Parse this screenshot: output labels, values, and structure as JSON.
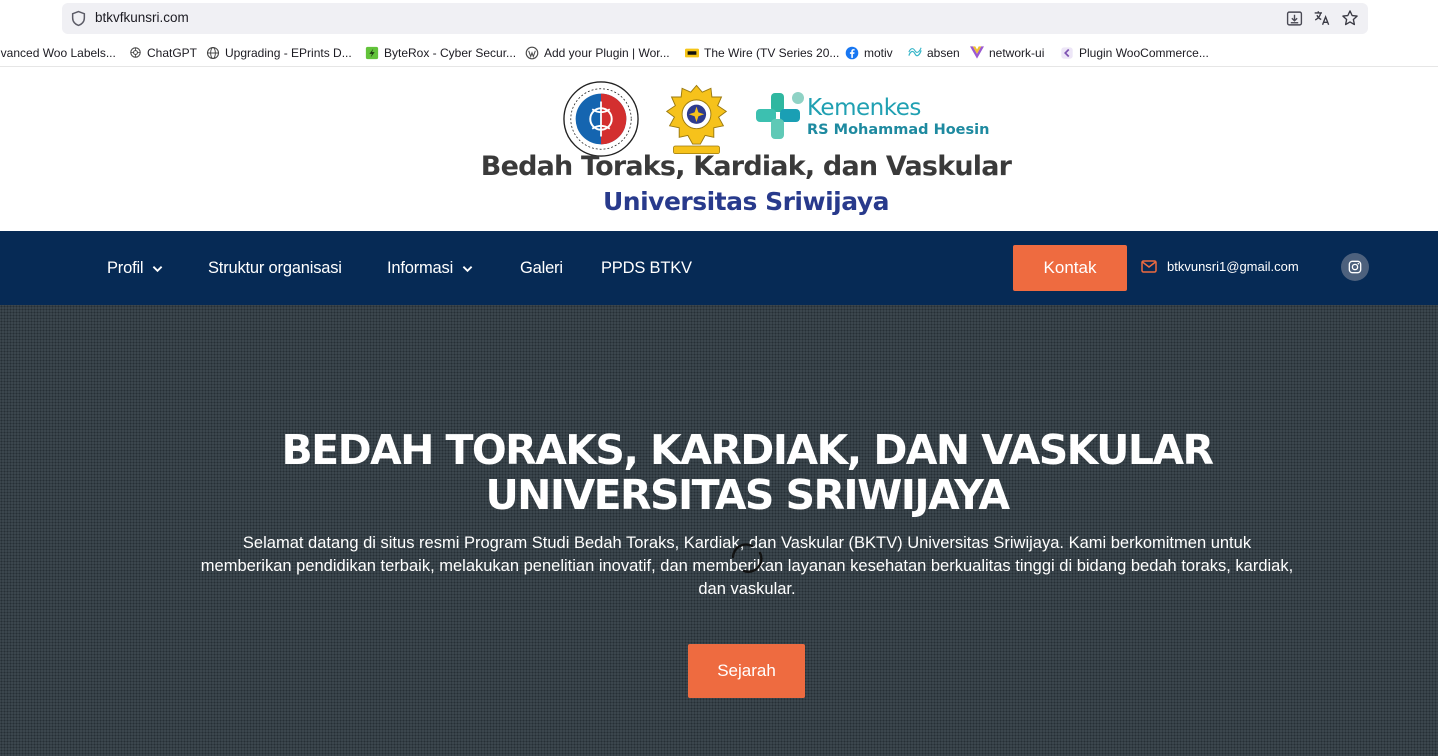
{
  "browser": {
    "url": "btkvfkunsri.com",
    "icons": [
      "shield-icon",
      "download-icon",
      "translate-icon",
      "star-icon"
    ]
  },
  "bookmarks": [
    {
      "label": "lvanced Woo Labels...",
      "icon": "none"
    },
    {
      "label": "ChatGPT",
      "icon": "chatgpt-icon"
    },
    {
      "label": "Upgrading - EPrints D...",
      "icon": "globe-icon"
    },
    {
      "label": "ByteRox - Cyber Secur...",
      "icon": "byterox-icon"
    },
    {
      "label": "Add your Plugin | Wor...",
      "icon": "wordpress-icon"
    },
    {
      "label": "The Wire (TV Series 20...",
      "icon": "imdb-icon"
    },
    {
      "label": "motiv",
      "icon": "facebook-icon"
    },
    {
      "label": "absen",
      "icon": "absen-icon"
    },
    {
      "label": "network-ui",
      "icon": "vue-icon"
    },
    {
      "label": "Plugin WooCommerce...",
      "icon": "woo-icon"
    }
  ],
  "header": {
    "kemenkes_name": "Kemenkes",
    "kemenkes_sub": "RS Mohammad Hoesin",
    "fk_logo_text": "Bedah Toraks, Kardiak, dan Vaskular · Universitas Sriwijaya",
    "unsri_logo_text": "ILMU AMAL PENGABDIAN",
    "title": "Bedah Toraks, Kardiak, dan Vaskular",
    "subtitle": "Universitas Sriwijaya"
  },
  "nav": {
    "items": [
      {
        "label": "Profil",
        "dropdown": true
      },
      {
        "label": "Struktur organisasi",
        "dropdown": false
      },
      {
        "label": "Informasi",
        "dropdown": true
      },
      {
        "label": "Galeri",
        "dropdown": false
      },
      {
        "label": "PPDS BTKV",
        "dropdown": false
      }
    ],
    "kontak_label": "Kontak",
    "email": "btkvunsri1@gmail.com"
  },
  "hero": {
    "title_line1": "BEDAH TORAKS, KARDIAK, DAN VASKULAR",
    "title_line2": "UNIVERSITAS SRIWIJAYA",
    "text": "Selamat datang di situs resmi Program Studi Bedah Toraks, Kardiak, dan Vaskular (BKTV) Universitas Sriwijaya. Kami berkomitmen untuk memberikan pendidikan terbaik, melakukan penelitian inovatif, dan memberikan layanan kesehatan berkualitas tinggi di bidang bedah toraks, kardiak, dan vaskular.",
    "button_label": "Sejarah"
  },
  "colors": {
    "nav_bg": "#062a55",
    "accent": "#ee6b40",
    "hero_bg": "#3c474e",
    "title_blue": "#283a8c",
    "kemenkes_teal": "#20a0b2"
  }
}
